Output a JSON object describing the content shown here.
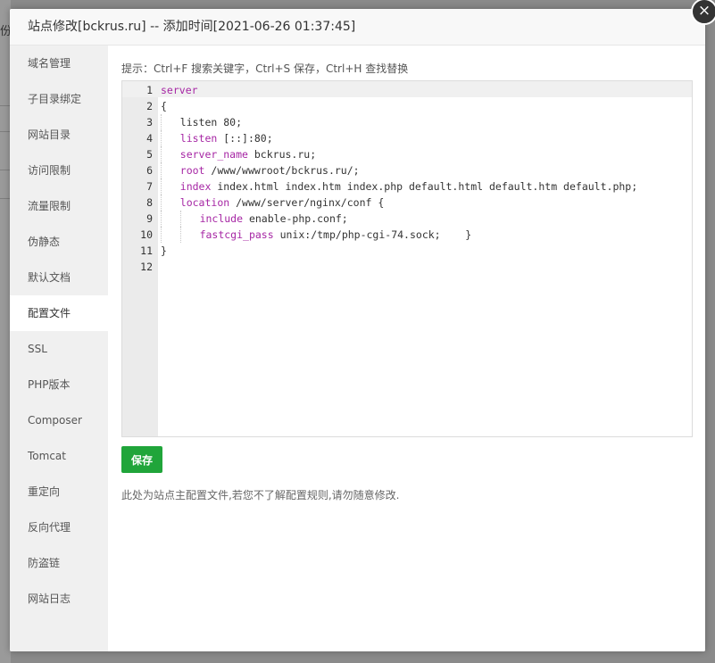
{
  "background": {
    "side_text": "份"
  },
  "modal": {
    "title": "站点修改[bckrus.ru] -- 添加时间[2021-06-26 01:37:45]",
    "close_glyph": "×"
  },
  "sidebar": {
    "items": [
      {
        "label": "域名管理"
      },
      {
        "label": "子目录绑定"
      },
      {
        "label": "网站目录"
      },
      {
        "label": "访问限制"
      },
      {
        "label": "流量限制"
      },
      {
        "label": "伪静态"
      },
      {
        "label": "默认文档"
      },
      {
        "label": "配置文件",
        "active": true
      },
      {
        "label": "SSL"
      },
      {
        "label": "PHP版本"
      },
      {
        "label": "Composer"
      },
      {
        "label": "Tomcat"
      },
      {
        "label": "重定向"
      },
      {
        "label": "反向代理"
      },
      {
        "label": "防盗链"
      },
      {
        "label": "网站日志"
      }
    ]
  },
  "editor": {
    "tip": "提示：Ctrl+F 搜索关键字，Ctrl+S 保存，Ctrl+H 查找替换",
    "line_numbers": [
      "1",
      "2",
      "3",
      "4",
      "5",
      "6",
      "7",
      "8",
      "9",
      "10",
      "11",
      "12"
    ],
    "lines": [
      {
        "indent": 0,
        "kw": "server",
        "rest": ""
      },
      {
        "indent": 0,
        "kw": "",
        "rest": "{"
      },
      {
        "indent": 1,
        "kw": "listen",
        "rest": " 80;",
        "kw_color": "plain"
      },
      {
        "indent": 1,
        "kw": "listen",
        "rest": " [::]:80;"
      },
      {
        "indent": 1,
        "kw": "server_name",
        "rest": " bckrus.ru;"
      },
      {
        "indent": 1,
        "kw": "root",
        "rest": " /www/wwwroot/bckrus.ru/;"
      },
      {
        "indent": 1,
        "kw": "index",
        "rest": " index.html index.htm index.php default.html default.htm default.php;"
      },
      {
        "indent": 1,
        "kw": "location",
        "rest": " /www/server/nginx/conf {"
      },
      {
        "indent": 2,
        "kw": "include",
        "rest": " enable-php.conf;"
      },
      {
        "indent": 2,
        "kw": "fastcgi_pass",
        "rest": " unix:/tmp/php-cgi-74.sock;    }"
      },
      {
        "indent": 0,
        "kw": "",
        "rest": "}"
      },
      {
        "indent": 0,
        "kw": "",
        "rest": ""
      }
    ],
    "colors": {
      "keyword": "#a626a4",
      "gutter": "#ebebeb"
    }
  },
  "actions": {
    "save_label": "保存",
    "save_color": "#20a53a"
  },
  "note": "此处为站点主配置文件,若您不了解配置规则,请勿随意修改."
}
